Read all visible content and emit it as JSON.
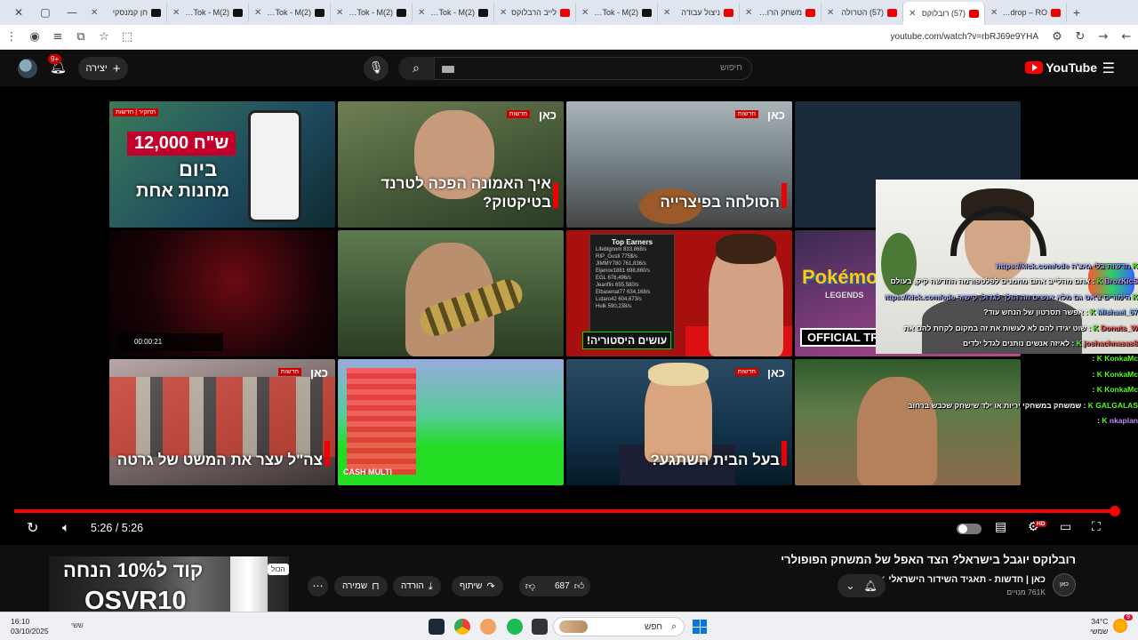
{
  "browser": {
    "window_controls": [
      "✕",
      "▢",
      "—"
    ],
    "tabs": [
      {
        "title": "חן קמנסקי",
        "favicon": "tiktok",
        "active": false
      },
      {
        "title": "(2)TikTok - M",
        "favicon": "tiktok",
        "active": false
      },
      {
        "title": "(2)TikTok - M",
        "favicon": "tiktok",
        "active": false
      },
      {
        "title": "(2)TikTok - M",
        "favicon": "tiktok",
        "active": false
      },
      {
        "title": "(2)TikTok - M",
        "favicon": "tiktok",
        "active": false
      },
      {
        "title": "לייב הרבלוקס",
        "favicon": "youtube",
        "active": false
      },
      {
        "title": "(2)TikTok - M",
        "favicon": "tiktok",
        "active": false
      },
      {
        "title": "ניצול עבודה",
        "favicon": "youtube",
        "active": false
      },
      {
        "title": "משחק הרובלוקס",
        "favicon": "youtube",
        "active": false
      },
      {
        "title": "(57) הטרולה",
        "favicon": "youtube",
        "active": false
      },
      {
        "title": "(57) רובלוקס",
        "favicon": "youtube",
        "active": true
      },
      {
        "title": "Airdrop – RO",
        "favicon": "youtube",
        "active": false
      }
    ],
    "url": "youtube.com/watch?v=rbRJ69e9YHA"
  },
  "youtube": {
    "logo": "YouTube",
    "search_placeholder": "חיפוש",
    "create_label": "יצירה",
    "notifications_badge": "9+"
  },
  "video": {
    "thumbnails": [
      {
        "caption_a": "12,000 ש\"ח",
        "caption_b": "ביום",
        "caption_c": "מחנות אחת",
        "tag": "תחקיר | חדשות"
      },
      {
        "caption": "איך האמונה הפכה לטרנד בטיקטוק?",
        "logo": "כאן",
        "tag": "חדשות"
      },
      {
        "caption": "הסולחה בפיצרייה",
        "logo": "כאן",
        "tag": "חדשות"
      },
      {
        "hud": "00:00:21"
      },
      {
        "caption": ""
      },
      {
        "board_title": "Top Earners",
        "board_rows": [
          "Lifeblgnom 833,868/s",
          "RIP_Gusti 775$/s",
          "JIMMY780 761,836/s",
          "Eljenov1881 698,860/s",
          "EGL 676,496/s",
          "Jeanflis 655,580/s",
          "Elbasenat77 634,168/s",
          "Lutaro42 604,673/s",
          "Hulk 590,238/s"
        ],
        "label": "עושים היסטוריה!"
      },
      {
        "brand": "Pokémon",
        "legends": "LEGENDS",
        "trailer": "OFFICIAL TRAILER"
      },
      {
        "caption": "צה\"ל עצר את המשט של גרטה",
        "logo": "כאן",
        "tag": "חדשות"
      },
      {
        "cash": "CASH MULTI"
      },
      {
        "caption": "בעל הבית השתגע?",
        "logo": "כאן",
        "tag": "חדשות"
      },
      {
        "caption": ""
      }
    ],
    "chat": [
      {
        "user": "",
        "text": "חדשות בלי גאצ'ה https://kick.com/ode",
        "cls": "lnk"
      },
      {
        "user": "BrozKicS",
        "text": "אתם מהלייב אתם מוזמנים לפלטפורמה החדשה קיק, בעולם",
        "cls": "pur"
      },
      {
        "user": "",
        "text": "הימורים צ'אט גם מלא אנשים וזה הולך לגדול, קישור https://kick.com/ode",
        "cls": "lnk"
      },
      {
        "user": "Mishael_67",
        "text": "אפשר תסרטון של הנחש עוד?",
        "cls": "blu"
      },
      {
        "user": "Donuts_W",
        "text": "שוט יגידו להם לא לעשות את זה במקום לקחת להם את",
        "cls": "red"
      },
      {
        "user": "joshachnasas8",
        "text": "לאיזה אנשים נותנים לגדל ילדים",
        "cls": "red"
      },
      {
        "user": "KonkaMc",
        "text": "",
        "cls": ""
      },
      {
        "user": "KonkaMc",
        "text": "",
        "cls": ""
      },
      {
        "user": "KonkaMc",
        "text": "",
        "cls": ""
      },
      {
        "user": "GALGALAS",
        "text": "שמשחק במשחקי יריות או ילד שישחק שכבש ברחוב",
        "cls": ""
      },
      {
        "user": "nkaplan",
        "text": "",
        "cls": "pur"
      }
    ],
    "progress_fraction": 1.0,
    "time_current": "5:26",
    "time_total": "5:26",
    "time_sep": " / "
  },
  "below": {
    "title": "רובלוקס יוגבל בישראל? הצד האפל של המשחק הפופולרי",
    "channel": "כאן | חדשות - תאגיד השידור הישראלי",
    "subscribers": "761K מנויים",
    "channel_avatar": "כאן",
    "likes": "687",
    "share": "שיתוף",
    "download": "הורדה",
    "save": "שמירה"
  },
  "ad": {
    "line1": "קוד ל10% הנחה",
    "line2": "OSVR10",
    "all_label": "הכול"
  },
  "taskbar": {
    "time": "16:10",
    "date": "03/10/2025",
    "search": "חפש",
    "temp": "34°C",
    "weather": "שמשי",
    "wbadge": "9",
    "status": "ששי"
  }
}
